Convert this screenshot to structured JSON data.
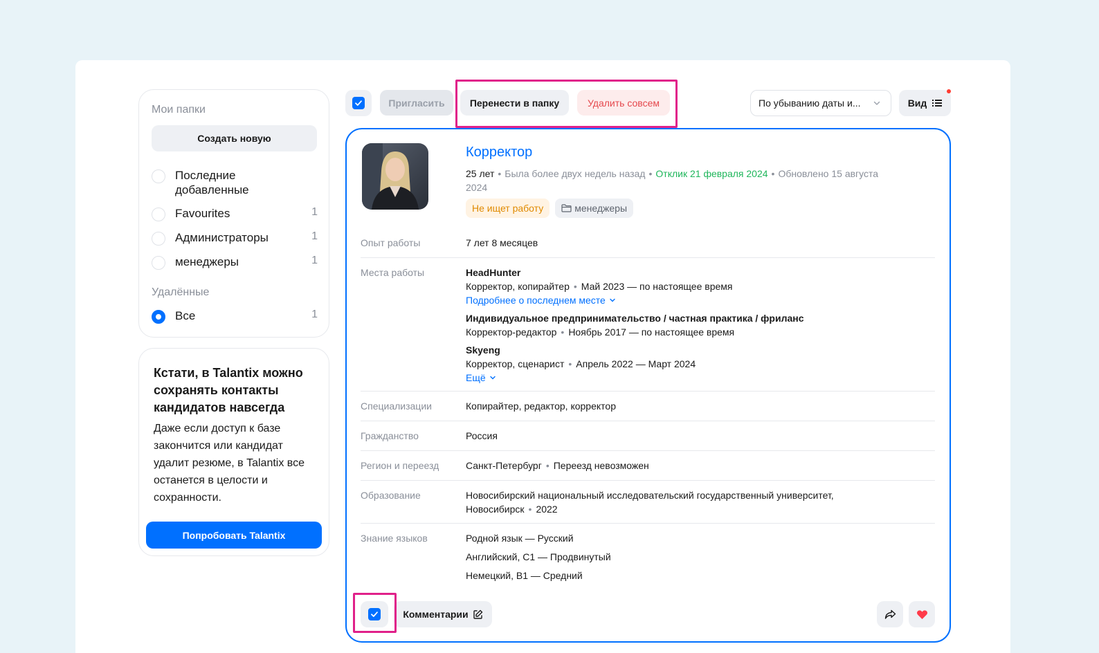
{
  "sidebar": {
    "folders_title": "Мои папки",
    "create_label": "Создать новую",
    "folders": [
      {
        "label": "Последние добавленные",
        "count": ""
      },
      {
        "label": "Favourites",
        "count": "1"
      },
      {
        "label": "Администраторы",
        "count": "1"
      },
      {
        "label": "менеджеры",
        "count": "1"
      }
    ],
    "deleted_title": "Удалённые",
    "deleted_item": {
      "label": "Все",
      "count": "1",
      "selected": true
    }
  },
  "promo": {
    "title": "Кстати, в Talantix можно сохранять контакты кандидатов навсегда",
    "text": "Даже если доступ к базе закончится или кандидат удалит резюме, в Talantix все останется в целости и сохранности.",
    "button": "Попробовать Talantix"
  },
  "toolbar": {
    "invite": "Пригласить",
    "move": "Перенести в папку",
    "delete": "Удалить совсем",
    "sort": "По убыванию даты и...",
    "view": "Вид"
  },
  "resume": {
    "title": "Корректор",
    "age": "25 лет",
    "last_seen": "Была более двух недель назад",
    "response": "Отклик 21 февраля 2024",
    "updated": "Обновлено 15 августа 2024",
    "tag_status": "Не ищет работу",
    "tag_folder": "менеджеры",
    "experience_label": "Опыт работы",
    "experience_value": "7 лет 8 месяцев",
    "workplaces_label": "Места работы",
    "jobs": [
      {
        "company": "HeadHunter",
        "position": "Корректор, копирайтер",
        "period": "Май 2023 — по настоящее время"
      },
      {
        "company": "Индивидуальное предпринимательство / частная практика / фриланс",
        "position": "Корректор-редактор",
        "period": "Ноябрь 2017 — по настоящее время"
      },
      {
        "company": "Skyeng",
        "position": "Корректор, сценарист",
        "period": "Апрель 2022 — Март 2024"
      }
    ],
    "more_about_last": "Подробнее о последнем месте",
    "more": "Ещё",
    "spec_label": "Специализации",
    "spec_value": "Копирайтер, редактор, корректор",
    "citizenship_label": "Гражданство",
    "citizenship_value": "Россия",
    "region_label": "Регион и переезд",
    "region_city": "Санкт-Петербург",
    "region_relocation": "Переезд невозможен",
    "education_label": "Образование",
    "education_value": "Новосибирский национальный исследовательский государственный университет,",
    "education_city": "Новосибирск",
    "education_year": "2022",
    "languages_label": "Знание языков",
    "languages": [
      "Родной язык — Русский",
      "Английский, C1 — Продвинутый",
      "Немецкий, B1 — Средний"
    ],
    "comments": "Комментарии"
  },
  "colors": {
    "accent": "#0070ff",
    "highlight": "#e0218a",
    "danger": "#e5484d",
    "success": "#1fb65b",
    "warning": "#e08a00"
  }
}
